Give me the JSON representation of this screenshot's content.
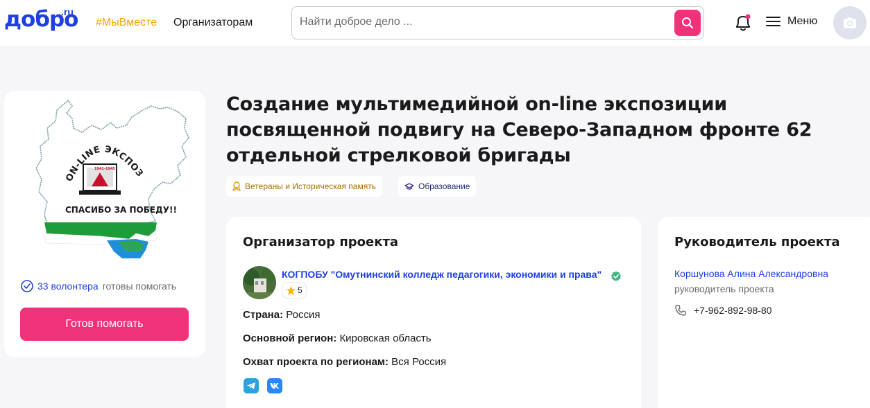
{
  "header": {
    "logo_text": "добро",
    "logo_suffix": ".ru",
    "nav_tag": "#МыВместе",
    "nav_org": "Организаторам",
    "search_placeholder": "Найти доброе дело ...",
    "menu_label": "Меню",
    "accent": "#f0327a",
    "brand": "#1f3fe0"
  },
  "project": {
    "image_text_top": "ON-LINE ЭКСПОЗИЦИЯ",
    "image_text_bottom": "СПАСИБО ЗА ПОБЕДУ!!",
    "volunteers_count": "33 волонтера",
    "volunteers_rest": "готовы помогать",
    "help_button": "Готов помогать",
    "title": "Создание мультимедийной on-line экспозиции посвященной подвигу на Северо-Западном фронте 62 отдельной стрелковой бригады",
    "tags": [
      {
        "label": "Ветераны и Историческая память",
        "icon": "ribbon-icon"
      },
      {
        "label": "Образование",
        "icon": "graduation-cap-icon"
      }
    ]
  },
  "organizer": {
    "heading": "Организатор проекта",
    "name": "КОГПОБУ \"Омутнинский колледж педагогики, экономики и права\"",
    "rating": "5",
    "country_label": "Страна:",
    "country": "Россия",
    "region_label": "Основной регион:",
    "region": "Кировская область",
    "coverage_label": "Охват проекта по регионам:",
    "coverage": "Вся Россия"
  },
  "leader": {
    "heading": "Руководитель проекта",
    "name": "Коршунова Алина Александровна",
    "role": "руководитель проекта",
    "phone": "+7-962-892-98-80"
  }
}
